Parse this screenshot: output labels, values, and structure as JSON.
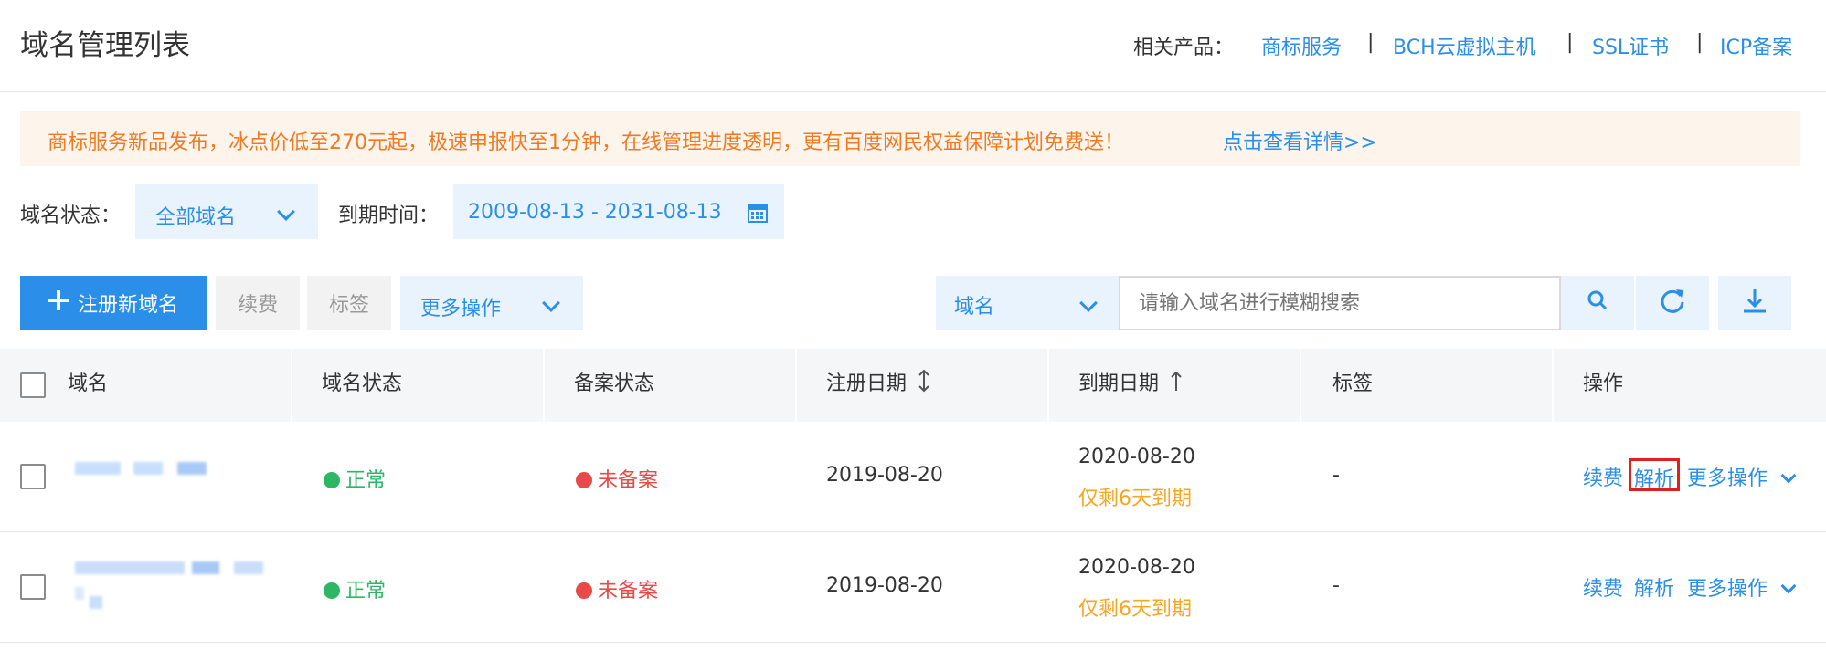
{
  "header": {
    "title": "域名管理列表",
    "related_label": "相关产品：",
    "links": [
      "商标服务",
      "BCH云虚拟主机",
      "SSL证书",
      "ICP备案"
    ],
    "separator": "|"
  },
  "banner": {
    "text": "商标服务新品发布，冰点价低至270元起，极速申报快至1分钟，在线管理进度透明，更有百度网民权益保障计划免费送！",
    "link": "点击查看详情>>"
  },
  "filters": {
    "status_label": "域名状态：",
    "status_value": "全部域名",
    "expiry_label": "到期时间：",
    "expiry_value": "2009-08-13 - 2031-08-13"
  },
  "toolbar": {
    "register": "注册新域名",
    "renew": "续费",
    "tag": "标签",
    "more": "更多操作",
    "search_type": "域名",
    "search_placeholder": "请输入域名进行模糊搜索"
  },
  "table": {
    "headers": [
      "域名",
      "域名状态",
      "备案状态",
      "注册日期",
      "到期日期",
      "标签",
      "操作"
    ],
    "rows": [
      {
        "status": "正常",
        "record": "未备案",
        "reg_date": "2019-08-20",
        "exp_date": "2020-08-20",
        "exp_note": "仅剩6天到期",
        "tag": "-",
        "op_renew": "续费",
        "op_resolve": "解析",
        "op_more": "更多操作"
      },
      {
        "status": "正常",
        "record": "未备案",
        "reg_date": "2019-08-20",
        "exp_date": "2020-08-20",
        "exp_note": "仅剩6天到期",
        "tag": "-",
        "op_renew": "续费",
        "op_resolve": "解析",
        "op_more": "更多操作"
      }
    ]
  },
  "colors": {
    "accent": "#2b8ee8",
    "primary_button": "#2b8ee8",
    "banner_bg": "#fdf4ec",
    "banner_text": "#f07a24",
    "status_ok": "#2bb764",
    "status_warn": "#e84a4a",
    "expiry_warn": "#f5a623",
    "highlight_box": "#e02020"
  },
  "icons": [
    "chevron-down-icon",
    "calendar-icon",
    "plus-icon",
    "search-icon",
    "refresh-icon",
    "download-icon",
    "sort-icon",
    "arrow-up-icon"
  ]
}
